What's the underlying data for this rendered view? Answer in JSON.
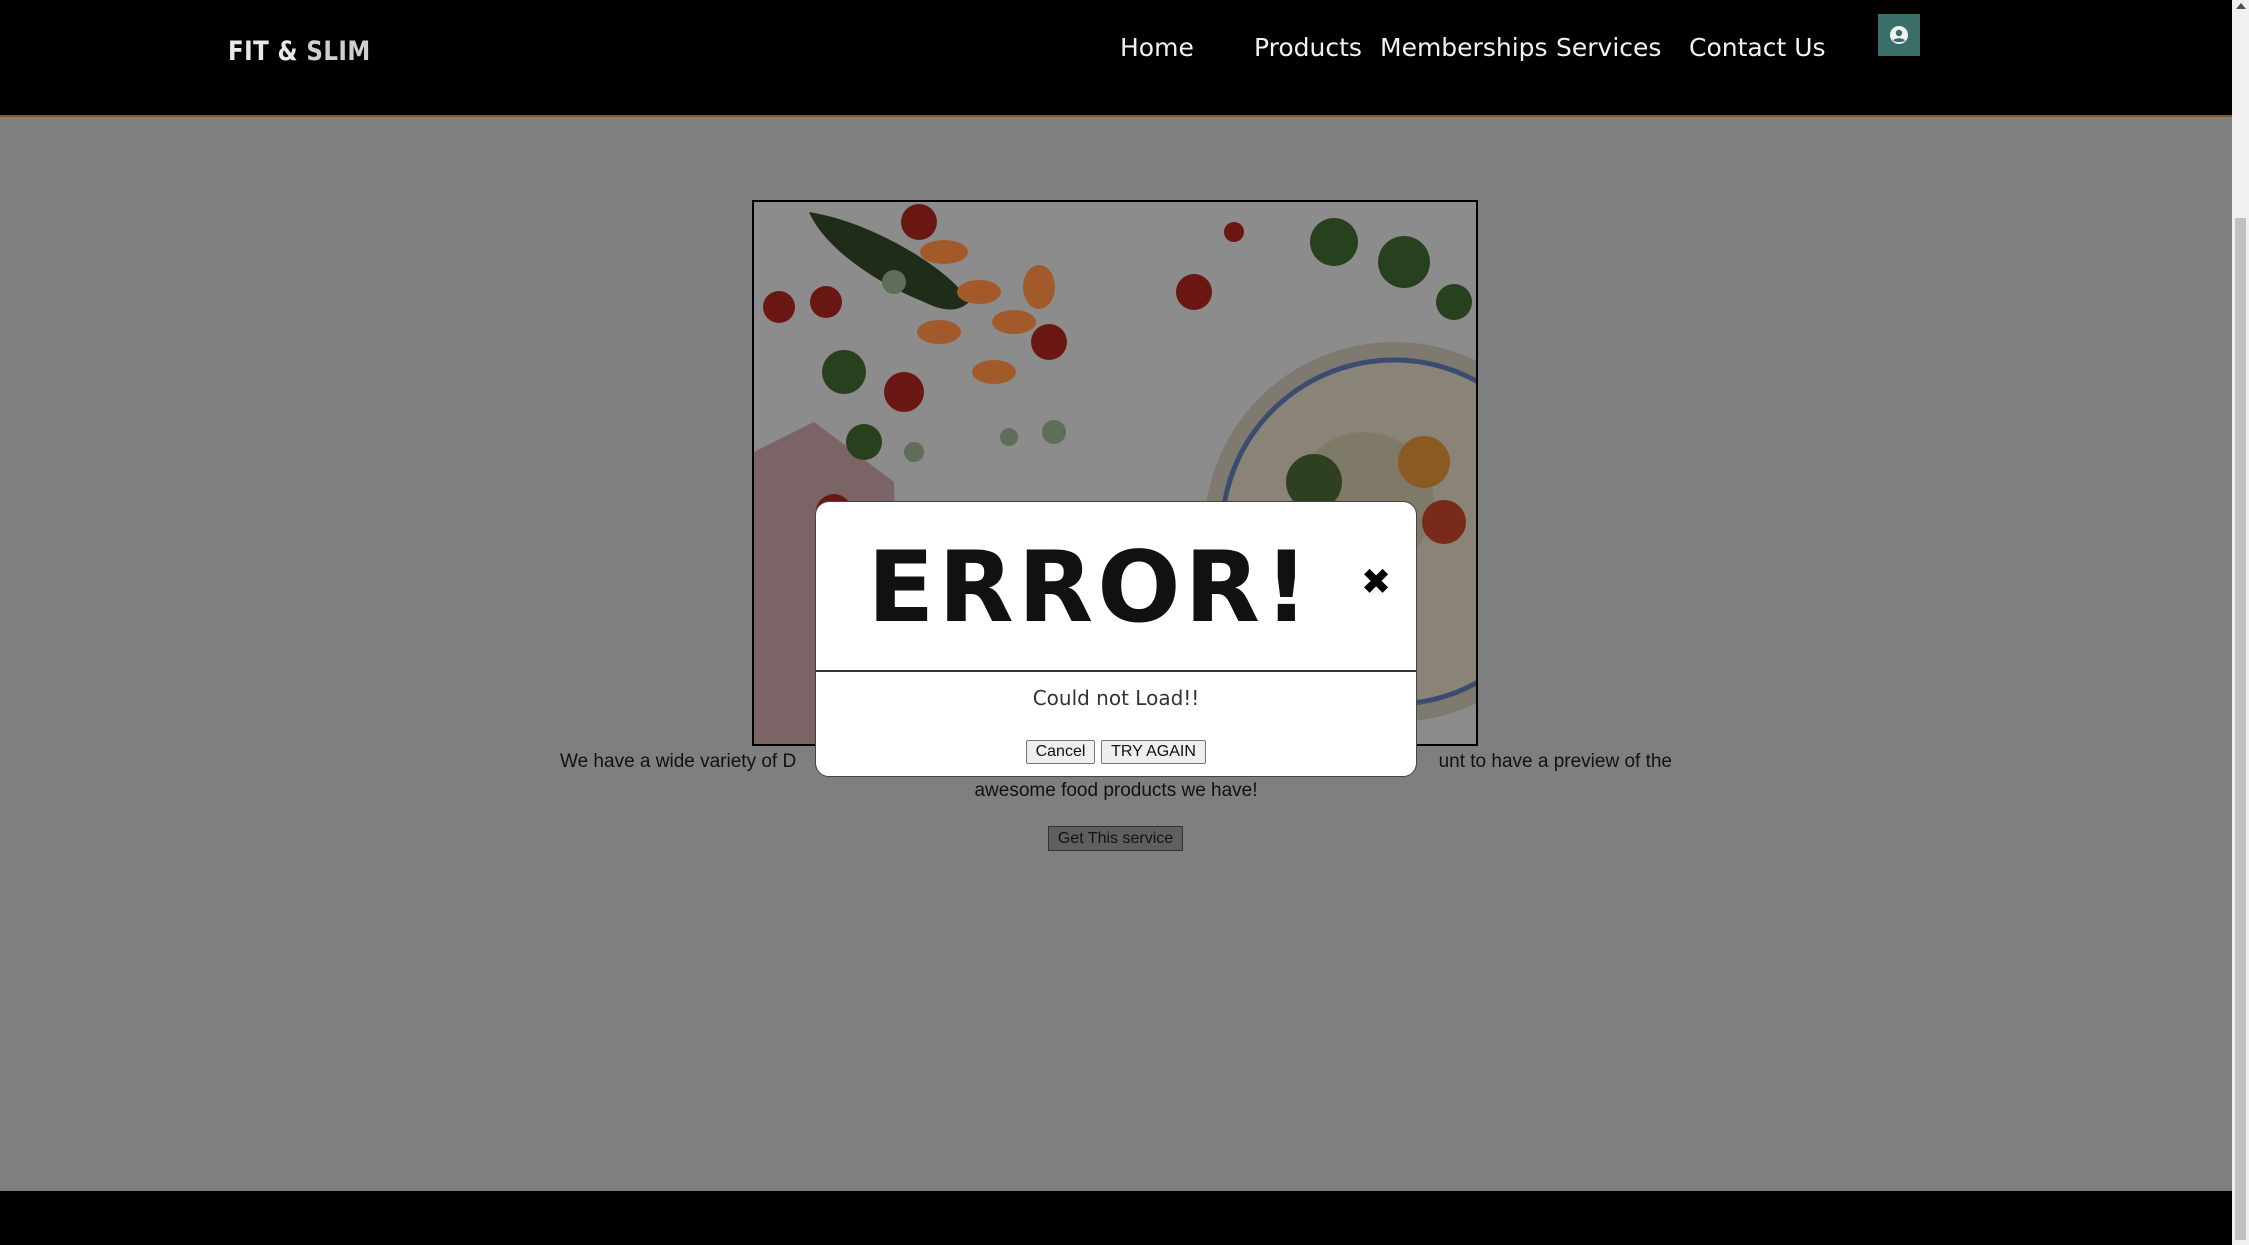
{
  "header": {
    "logo_part1": "FIT &",
    "logo_part2": "SLIM",
    "nav": [
      {
        "label": "Home"
      },
      {
        "label": "Products"
      },
      {
        "label": "Memberships"
      },
      {
        "label": "Services"
      },
      {
        "label": "Contact Us"
      }
    ],
    "user_icon": "user-circle-icon"
  },
  "main": {
    "image_subject": "vegetables-and-rice-bowl",
    "description": "We have a wide variety of D                                                                                                   unt to have a preview of the awesome food products we have!",
    "description_line1_left": "We have a wide variety of D",
    "description_line1_right": "unt to have a preview of the",
    "description_line2": "awesome food products we have!",
    "cta_label": "Get This service"
  },
  "modal": {
    "title": "ERROR!",
    "close_icon": "close-x-icon",
    "message": "Could not Load!!",
    "cancel_label": "Cancel",
    "retry_label": "TRY AGAIN"
  },
  "colors": {
    "header_bg": "#000000",
    "overlay": "#7f7f7f",
    "user_button": "#3a6f69",
    "accent_border": "#7a5a24"
  }
}
